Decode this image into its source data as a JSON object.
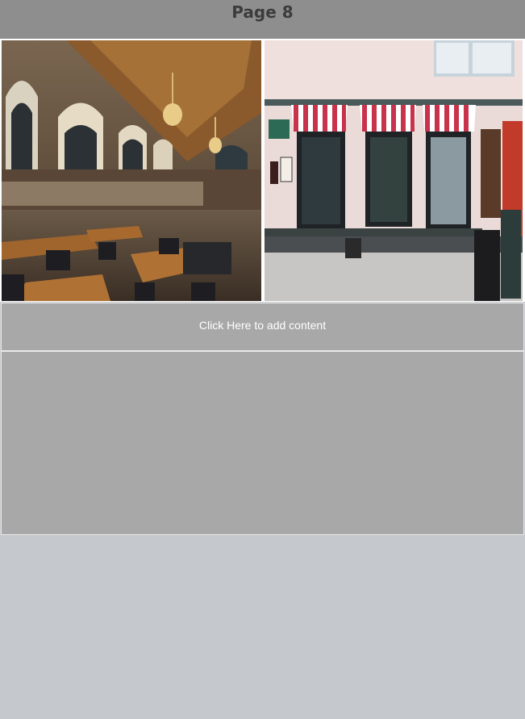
{
  "header": {
    "title": "Page 8"
  },
  "photos": [
    {
      "name": "ornate-hall-dining-photo",
      "alt": "Grand hall with arched windows and tables"
    },
    {
      "name": "cafe-storefront-photo",
      "alt": "Cafe storefront with striped awnings"
    }
  ],
  "add_content": {
    "label": "Click Here to add content"
  },
  "colors": {
    "header_bg": "#8e8e8e",
    "panel_bg": "#a8a8a8",
    "page_bg": "#c5c8cc"
  }
}
